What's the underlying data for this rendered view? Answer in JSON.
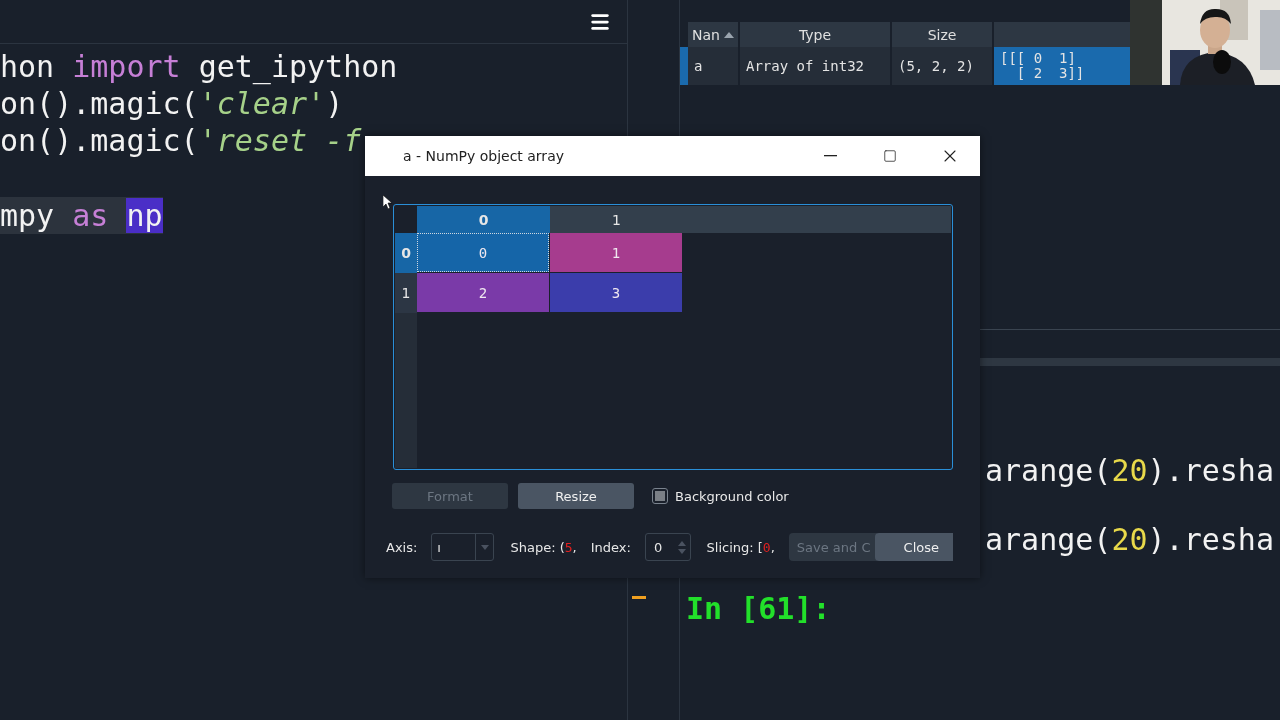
{
  "editor": {
    "lines": [
      {
        "current": false,
        "tokens": [
          {
            "kind": "plain",
            "text": "hon "
          },
          {
            "kind": "keyword",
            "text": "import"
          },
          {
            "kind": "plain",
            "text": " get_ipython"
          }
        ]
      },
      {
        "current": false,
        "tokens": [
          {
            "kind": "plain",
            "text": "on().magic("
          },
          {
            "kind": "string",
            "text": "'clear'"
          },
          {
            "kind": "plain",
            "text": ")"
          }
        ]
      },
      {
        "current": false,
        "tokens": [
          {
            "kind": "plain",
            "text": "on().magic("
          },
          {
            "kind": "string",
            "text": "'reset -f"
          }
        ]
      },
      {
        "spaced": true,
        "current": true,
        "tokens": [
          {
            "kind": "plain",
            "text": "mpy "
          },
          {
            "kind": "keyword",
            "text": "as "
          },
          {
            "kind": "highlight",
            "text": "np"
          }
        ]
      }
    ]
  },
  "variables": {
    "columns": [
      {
        "label": "Nan",
        "sort_ascending": true
      },
      {
        "label": "Type"
      },
      {
        "label": "Size"
      }
    ],
    "rows": [
      {
        "selected": true,
        "name": "a",
        "type": "Array of int32",
        "size": "(5, 2, 2)",
        "value": [
          "[[[ 0  1]",
          "  [ 2  3]]"
        ]
      }
    ]
  },
  "console": {
    "lines": [
      {
        "tokens": [
          {
            "kind": "plain",
            "text": "arange("
          },
          {
            "kind": "number",
            "text": "20"
          },
          {
            "kind": "plain",
            "text": ").resha"
          }
        ]
      },
      {
        "tokens": [
          {
            "kind": "plain",
            "text": "arange("
          },
          {
            "kind": "number",
            "text": "20"
          },
          {
            "kind": "plain",
            "text": ").resha"
          }
        ]
      }
    ],
    "prompt": "In [61]:"
  },
  "dialog": {
    "title": "a - NumPy object array",
    "table": {
      "columns": [
        {
          "label": "0",
          "selected": true
        },
        {
          "label": "1",
          "selected": false
        }
      ],
      "rows": [
        {
          "label": "0",
          "selected": true,
          "cells": [
            {
              "value": "0",
              "color": "#1565a8",
              "selected": true
            },
            {
              "value": "1",
              "color": "#a63c8e",
              "selected": false
            }
          ]
        },
        {
          "label": "1",
          "selected": false,
          "cells": [
            {
              "value": "2",
              "color": "#7a3aa8",
              "selected": false
            },
            {
              "value": "3",
              "color": "#3b3dab",
              "selected": false
            }
          ]
        }
      ]
    },
    "buttons": [
      {
        "label": "Format",
        "disabled": true
      },
      {
        "label": "Resize",
        "disabled": false
      }
    ],
    "background_color": {
      "label": "Background color",
      "checked": false
    },
    "axis": {
      "label": "Axis:",
      "value": "ı"
    },
    "shape": [
      {
        "kind": "plain",
        "text": "Shape: ("
      },
      {
        "kind": "error",
        "text": "5"
      },
      {
        "kind": "plain",
        "text": ","
      }
    ],
    "index": {
      "label": "Index:",
      "value": "0"
    },
    "slicing": [
      {
        "kind": "plain",
        "text": "Slicing: ["
      },
      {
        "kind": "error",
        "text": "0"
      },
      {
        "kind": "plain",
        "text": ","
      }
    ],
    "save_button": {
      "label": "Save and C",
      "disabled": true
    },
    "close_button": {
      "label": "Close"
    }
  }
}
